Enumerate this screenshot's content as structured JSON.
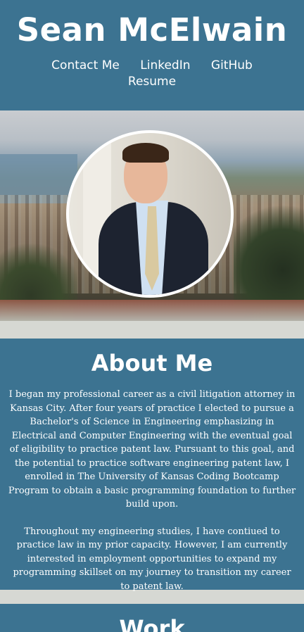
{
  "header": {
    "name": "Sean McElwain",
    "nav": {
      "contact": "Contact Me",
      "linkedin": "LinkedIn",
      "github": "GitHub",
      "resume": "Resume"
    }
  },
  "about": {
    "title": "About Me",
    "paragraph1": "I began my professional career as a civil litigation attorney in Kansas City. After four years of practice I elected to pursue a Bachelor's of Science in Engineering emphasizing in Electrical and Computer Engineering with the eventual goal of eligibility to practice patent law. Pursuant to this goal, and the potential to practice software engineering patent law, I enrolled in The University of Kansas Coding Bootcamp Program to obtain a basic programming foundation to further build upon.",
    "paragraph2": "Throughout my engineering studies, I have contiued to practice law in my prior capacity. However, I am currently interested in employment opportunities to expand my programming skillset on my journey to transition my career to patent law."
  },
  "work": {
    "title": "Work"
  },
  "colors": {
    "primary": "#3c7391",
    "background": "#d6d8d3",
    "text": "#ffffff"
  }
}
